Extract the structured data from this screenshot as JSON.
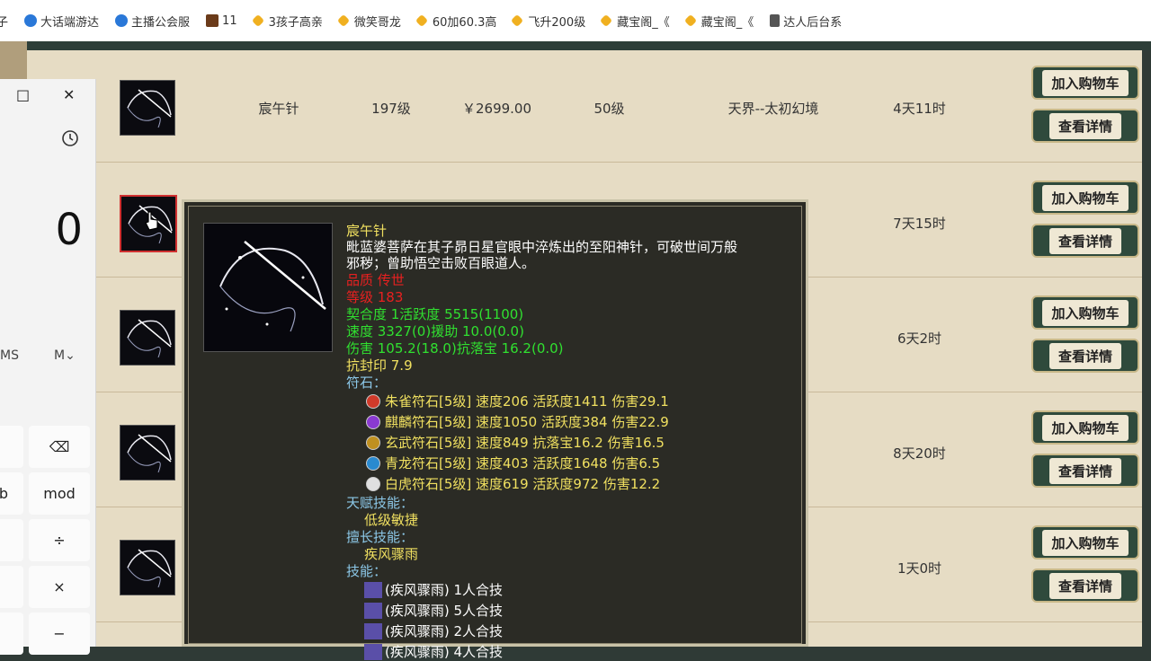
{
  "bookmarks": [
    {
      "label": "子",
      "icon": "none"
    },
    {
      "label": "大话端游达",
      "icon": "blue"
    },
    {
      "label": "主播公会服",
      "icon": "blue"
    },
    {
      "label": "11",
      "icon": "game"
    },
    {
      "label": "3孩子高亲",
      "icon": "dragon"
    },
    {
      "label": "微笑哥龙",
      "icon": "dragon"
    },
    {
      "label": "60加60.3高",
      "icon": "dragon"
    },
    {
      "label": "飞升200级",
      "icon": "dragon"
    },
    {
      "label": "藏宝阁_《",
      "icon": "dragon"
    },
    {
      "label": "藏宝阁_《",
      "icon": "dragon"
    },
    {
      "label": "达人后台系",
      "icon": "doc"
    }
  ],
  "listing": {
    "buy_label": "加入购物车",
    "detail_label": "查看详情",
    "rows": [
      {
        "name": "宸午针",
        "level": "197级",
        "price": "￥2699.00",
        "req": "50级",
        "server": "天界--太初幻境",
        "time": "4天11时"
      },
      {
        "name": "",
        "level": "",
        "price": "",
        "req": "",
        "server": "",
        "time": "7天15时"
      },
      {
        "name": "",
        "level": "",
        "price": "",
        "req": "",
        "server": "",
        "time": "6天2时"
      },
      {
        "name": "",
        "level": "",
        "price": "",
        "req": "",
        "server": "",
        "time": "8天20时"
      },
      {
        "name": "",
        "level": "",
        "price": "",
        "req": "",
        "server": "",
        "time": "1天0时"
      }
    ]
  },
  "calculator": {
    "maximize_icon": "□",
    "close_icon": "✕",
    "display": "0",
    "ms": "MS",
    "mplus": "M⌄",
    "keys": {
      "backspace": "⌫",
      "mod": "mod",
      "divide": "÷",
      "multiply": "×",
      "minus": "−",
      "partial_left": "b"
    }
  },
  "tooltip": {
    "name": "宸午针",
    "desc_line1": "毗蓝婆菩萨在其子昴日星官眼中淬炼出的至阳神针，可破世间万般",
    "desc_line2": "邪秽；曾助悟空击败百眼道人。",
    "quality": "品质   传世",
    "level": "等级   183",
    "stats": [
      "契合度     1活跃度  5515(1100)",
      "速度     3327(0)援助     10.0(0.0)",
      "伤害    105.2(18.0)抗落宝     16.2(0.0)"
    ],
    "anti_seal": "抗封印 7.9",
    "rune_header": "符石：",
    "runes": [
      {
        "text": "朱雀符石[5级] 速度206 活跃度1411 伤害29.1",
        "color": "#d03a2a"
      },
      {
        "text": "麒麟符石[5级] 速度1050 活跃度384 伤害22.9",
        "color": "#8a3ad0"
      },
      {
        "text": "玄武符石[5级] 速度849 抗落宝16.2 伤害16.5",
        "color": "#c09020"
      },
      {
        "text": "青龙符石[5级] 速度403 活跃度1648 伤害6.5",
        "color": "#2a8ad0"
      },
      {
        "text": "白虎符石[5级] 速度619 活跃度972 伤害12.2",
        "color": "#e0e0e0"
      }
    ],
    "talent_header": "天赋技能：",
    "talent": "低级敏捷",
    "special_header": "擅长技能：",
    "special": "疾风骤雨",
    "skill_header": "技能：",
    "skills": [
      "(疾风骤雨) 1人合技",
      "(疾风骤雨) 5人合技",
      "(疾风骤雨) 2人合技",
      "(疾风骤雨) 4人合技"
    ]
  }
}
